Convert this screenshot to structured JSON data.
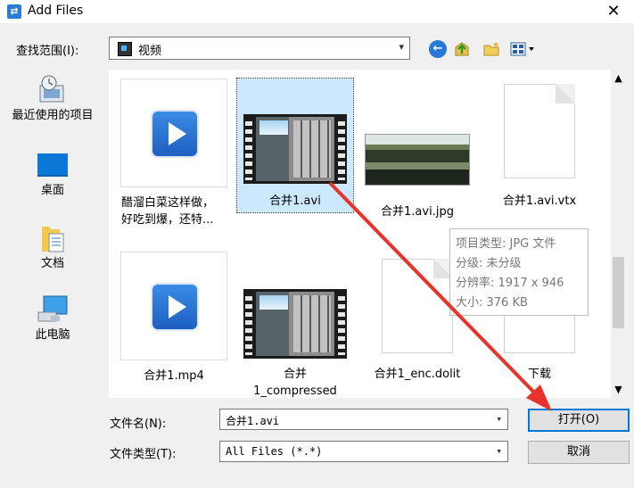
{
  "window": {
    "title": "Add Files",
    "close_icon": "close-icon"
  },
  "look_in": {
    "label": "查找范围(I):",
    "value": "视频"
  },
  "toolbar": {
    "icons": [
      "back-icon",
      "up-folder-icon",
      "new-folder-icon",
      "view-menu-icon"
    ]
  },
  "places": [
    {
      "label": "最近使用的项目",
      "icon": "recent-items-icon"
    },
    {
      "label": "桌面",
      "icon": "desktop-icon"
    },
    {
      "label": "文档",
      "icon": "documents-icon"
    },
    {
      "label": "此电脑",
      "icon": "this-pc-icon"
    }
  ],
  "files": [
    {
      "name": "醋溜白菜这样做，好吃到爆，还特...",
      "line1": "醋溜白菜这样做，",
      "line2": "好吃到爆，还特...",
      "kind": "video-app"
    },
    {
      "name": "合并1.avi",
      "kind": "video-thumb",
      "selected": true
    },
    {
      "name": "合并1.avi.jpg",
      "kind": "image"
    },
    {
      "name": "合并1.avi.vtx",
      "kind": "document"
    },
    {
      "name": "合并1.mp4",
      "kind": "video-app"
    },
    {
      "name": "合并1_compressed",
      "line1": "合并",
      "line2": "1_compressed",
      "kind": "video-thumb"
    },
    {
      "name": "合并1_enc.dolit",
      "kind": "document"
    },
    {
      "name": "下载",
      "kind": "document"
    }
  ],
  "tooltip": {
    "type": "项目类型: JPG 文件",
    "rating": "分级: 未分级",
    "resolution": "分辨率: 1917 x 946",
    "size": "大小: 376 KB"
  },
  "filename": {
    "label": "文件名(N):",
    "value": "合并1.avi"
  },
  "filetype": {
    "label": "文件类型(T):",
    "value": "All Files (*.*)"
  },
  "buttons": {
    "open": "打开(O)",
    "cancel": "取消"
  },
  "colors": {
    "selection": "#cce8ff",
    "accent": "#0078d7",
    "annotation_arrow": "#e8332a"
  }
}
